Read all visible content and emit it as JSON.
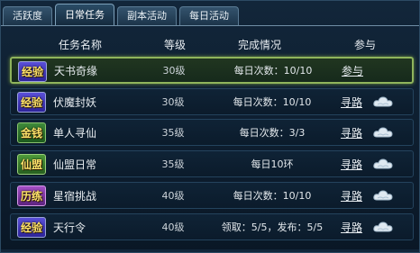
{
  "tabs": [
    "活跃度",
    "日常任务",
    "副本活动",
    "每日活动"
  ],
  "active_tab": 1,
  "columns": {
    "name": "任务名称",
    "level": "等级",
    "status": "完成情况",
    "join": "参与"
  },
  "tasks": [
    {
      "badge": "经验",
      "badge_icon": "exp-badge-icon",
      "name": "天书奇缘",
      "level": "30级",
      "status": "每日次数：10/10",
      "action": "参与",
      "cloud": false,
      "selected": true
    },
    {
      "badge": "经验",
      "badge_icon": "exp-badge-icon",
      "name": "伏魔封妖",
      "level": "30级",
      "status": "每日次数：10/10",
      "action": "寻路",
      "cloud": true,
      "selected": false
    },
    {
      "badge": "金钱",
      "badge_icon": "gold-badge-icon",
      "name": "单人寻仙",
      "level": "35级",
      "status": "每日次数：3/3",
      "action": "寻路",
      "cloud": true,
      "selected": false
    },
    {
      "badge": "仙盟",
      "badge_icon": "alliance-badge-icon",
      "name": "仙盟日常",
      "level": "35级",
      "status": "每日10环",
      "action": "寻路",
      "cloud": true,
      "selected": false
    },
    {
      "badge": "历练",
      "badge_icon": "training-badge-icon",
      "name": "星宿挑战",
      "level": "40级",
      "status": "每日次数：10/10",
      "action": "寻路",
      "cloud": true,
      "selected": false
    },
    {
      "badge": "经验",
      "badge_icon": "exp-badge-icon",
      "name": "天行令",
      "level": "40级",
      "status": "领取：5/5，发布：5/5",
      "action": "寻路",
      "cloud": true,
      "selected": false
    }
  ]
}
